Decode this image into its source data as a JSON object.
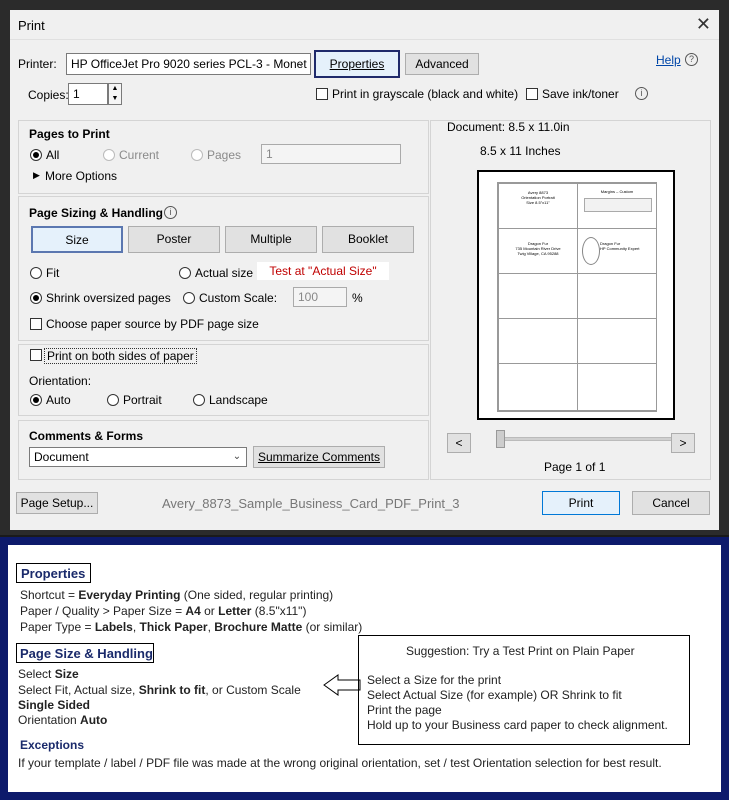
{
  "dialog": {
    "title": "Print",
    "close_glyph": "✕",
    "help_label": "Help",
    "printer": {
      "label": "Printer:",
      "value": "HP OfficeJet Pro 9020 series PCL-3 - Monet"
    },
    "properties_button": "Properties",
    "advanced_button": "Advanced",
    "copies": {
      "label": "Copies:",
      "value": "1"
    },
    "grayscale_label": "Print in grayscale (black and white)",
    "save_ink_label": "Save ink/toner",
    "pages_to_print": {
      "heading": "Pages to Print",
      "all": "All",
      "current": "Current",
      "pages": "Pages",
      "pages_value": "1",
      "more_options": "More Options"
    },
    "sizing": {
      "heading": "Page Sizing & Handling",
      "tabs": [
        "Size",
        "Poster",
        "Multiple",
        "Booklet"
      ],
      "fit": "Fit",
      "actual_size": "Actual size",
      "test_note": "Test at \"Actual Size\"",
      "shrink": "Shrink oversized pages",
      "custom_scale": "Custom Scale:",
      "custom_value": "100",
      "percent": "%",
      "choose_source": "Choose paper source by PDF page size"
    },
    "duplex_label": "Print on both sides of paper",
    "orientation": {
      "label": "Orientation:",
      "auto": "Auto",
      "portrait": "Portrait",
      "landscape": "Landscape"
    },
    "comments": {
      "heading": "Comments & Forms",
      "value": "Document",
      "summarize": "Summarize Comments"
    },
    "preview": {
      "document_size": "Document: 8.5 x 11.0in",
      "paper_size": "8.5 x 11 Inches",
      "prev": "<",
      "next": ">",
      "page_of": "Page 1 of 1",
      "label1": "Avery 8873\nOrientation Portrait\nSize 8.5\"x11\"",
      "label2": "Margins – Custom",
      "label3": "Dragon Fur\n735 Mountain River Drive\nTwig Village, CA 95288",
      "label4": "Dragon Fur\nHP Community Expert"
    },
    "page_setup": "Page Setup...",
    "filename": "Avery_8873_Sample_Business_Card_PDF_Print_3",
    "print_button": "Print",
    "cancel_button": "Cancel"
  },
  "notes": {
    "properties_heading": "Properties",
    "shortcut_a": "Shortcut = ",
    "shortcut_b": "Everyday Printing",
    "shortcut_c": " (One sided, regular printing)",
    "paper_a": "Paper / Quality > Paper Size = ",
    "paper_b": "A4",
    "paper_c": " or ",
    "paper_d": "Letter",
    "paper_e": " (8.5\"x11\")",
    "type_a": "Paper Type = ",
    "type_b": "Labels",
    "type_c": ", ",
    "type_d": "Thick Paper",
    "type_e": ", ",
    "type_f": "Brochure Matte",
    "type_g": " (or similar)",
    "handling_heading": "Page Size & Handling",
    "select_a": "Select ",
    "select_b": "Size",
    "fit_a": "Select Fit, Actual size, ",
    "fit_b": "Shrink to fit",
    "fit_c": ", or Custom Scale",
    "single_sided": "Single Sided",
    "orient_a": "Orientation ",
    "orient_b": "Auto",
    "exceptions_heading": "Exceptions",
    "exceptions_text": "If your template / label / PDF file was made at the wrong original orientation, set / test Orientation selection for best result.",
    "suggestion_title": "Suggestion:  Try a Test Print on Plain Paper",
    "suggestion_1": "Select a Size for the print",
    "suggestion_2": "Select Actual Size (for example) OR Shrink to fit",
    "suggestion_3": "Print the page",
    "suggestion_4": "Hold up to your Business card paper to check alignment."
  }
}
